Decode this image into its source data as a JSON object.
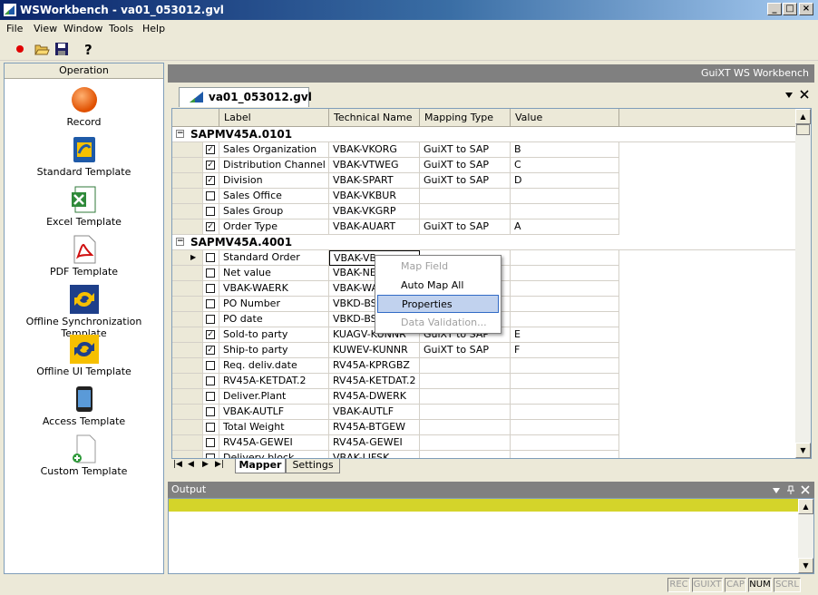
{
  "window": {
    "title": "WSWorkbench - va01_053012.gvl",
    "btn_min": "_",
    "btn_max": "□",
    "btn_close": "×"
  },
  "menu": [
    {
      "label": "File"
    },
    {
      "label": "View"
    },
    {
      "label": "Window"
    },
    {
      "label": "Tools"
    },
    {
      "label": "Help"
    }
  ],
  "toolbar": {
    "record_icon": "record-icon",
    "open_icon": "folder-open-icon",
    "save_icon": "save-icon",
    "help_icon": "help-icon"
  },
  "left_panel": {
    "header": "Operation",
    "templates": [
      {
        "label": "Record",
        "icon": "record-icon"
      },
      {
        "label": "Standard Template",
        "icon": "standard-template-icon"
      },
      {
        "label": "Excel Template",
        "icon": "excel-icon"
      },
      {
        "label": "PDF Template",
        "icon": "pdf-icon"
      },
      {
        "label": "Offline Synchronization Template",
        "icon": "sync-icon"
      },
      {
        "label": "Offline UI Template",
        "icon": "sync-icon"
      },
      {
        "label": "Access Template",
        "icon": "device-icon"
      },
      {
        "label": "Custom Template",
        "icon": "custom-doc-icon"
      }
    ]
  },
  "right_header": "GuiXT WS Workbench",
  "doc_tab": {
    "label": "va01_053012.gvl"
  },
  "grid": {
    "columns": [
      "Label",
      "Technical Name",
      "Mapping Type",
      "Value"
    ],
    "groups": [
      {
        "name": "SAPMV45A.0101",
        "rows": [
          {
            "checked": true,
            "label": "Sales Organization",
            "tech": "VBAK-VKORG",
            "mapping": "GuiXT to SAP",
            "value": "B"
          },
          {
            "checked": true,
            "label": "Distribution Channel",
            "tech": "VBAK-VTWEG",
            "mapping": "GuiXT to SAP",
            "value": "C"
          },
          {
            "checked": true,
            "label": "Division",
            "tech": "VBAK-SPART",
            "mapping": "GuiXT to SAP",
            "value": "D"
          },
          {
            "checked": false,
            "label": "Sales Office",
            "tech": "VBAK-VKBUR",
            "mapping": "",
            "value": ""
          },
          {
            "checked": false,
            "label": "Sales Group",
            "tech": "VBAK-VKGRP",
            "mapping": "",
            "value": ""
          },
          {
            "checked": true,
            "label": "Order Type",
            "tech": "VBAK-AUART",
            "mapping": "GuiXT to SAP",
            "value": "A"
          }
        ]
      },
      {
        "name": "SAPMV45A.4001",
        "rows": [
          {
            "checked": false,
            "label": "Standard Order",
            "tech": "VBAK-VB",
            "mapping": "",
            "value": "",
            "current": true
          },
          {
            "checked": false,
            "label": "Net value",
            "tech": "VBAK-NE",
            "mapping": "",
            "value": ""
          },
          {
            "checked": false,
            "label": "VBAK-WAERK",
            "tech": "VBAK-WA",
            "mapping": "",
            "value": ""
          },
          {
            "checked": false,
            "label": "PO Number",
            "tech": "VBKD-BS",
            "mapping": "",
            "value": ""
          },
          {
            "checked": false,
            "label": "PO date",
            "tech": "VBKD-BS",
            "mapping": "",
            "value": ""
          },
          {
            "checked": true,
            "label": "Sold-to party",
            "tech": "KUAGV-KUNNR",
            "mapping": "GuiXT to SAP",
            "value": "E"
          },
          {
            "checked": true,
            "label": "Ship-to party",
            "tech": "KUWEV-KUNNR",
            "mapping": "GuiXT to SAP",
            "value": "F"
          },
          {
            "checked": false,
            "label": "Req. deliv.date",
            "tech": "RV45A-KPRGBZ",
            "mapping": "",
            "value": ""
          },
          {
            "checked": false,
            "label": "RV45A-KETDAT.2",
            "tech": "RV45A-KETDAT.2",
            "mapping": "",
            "value": ""
          },
          {
            "checked": false,
            "label": "Deliver.Plant",
            "tech": "RV45A-DWERK",
            "mapping": "",
            "value": ""
          },
          {
            "checked": false,
            "label": "VBAK-AUTLF",
            "tech": "VBAK-AUTLF",
            "mapping": "",
            "value": ""
          },
          {
            "checked": false,
            "label": "Total Weight",
            "tech": "RV45A-BTGEW",
            "mapping": "",
            "value": ""
          },
          {
            "checked": false,
            "label": "RV45A-GEWEI",
            "tech": "RV45A-GEWEI",
            "mapping": "",
            "value": ""
          },
          {
            "checked": false,
            "label": "Delivery block",
            "tech": "VBAK-LIFSK",
            "mapping": "",
            "value": ""
          }
        ]
      }
    ]
  },
  "bottom_tabs": [
    {
      "label": "Mapper",
      "active": true
    },
    {
      "label": "Settings",
      "active": false
    }
  ],
  "context_menu": {
    "items": [
      {
        "label": "Map Field",
        "disabled": true
      },
      {
        "label": "Auto Map All",
        "disabled": false
      },
      {
        "label": "Properties",
        "disabled": false,
        "highlighted": true
      },
      {
        "label": "Data Validation...",
        "disabled": true
      }
    ]
  },
  "output": {
    "title": "Output"
  },
  "statusbar": {
    "indicators": [
      "REC",
      "GUIXT",
      "CAP",
      "NUM",
      "SCRL"
    ],
    "active": "NUM"
  },
  "colors": {
    "title_start": "#0a246a",
    "title_end": "#a6caf0",
    "output_bar": "#d4d42a",
    "menu_highlight": "#c1d2ee"
  }
}
